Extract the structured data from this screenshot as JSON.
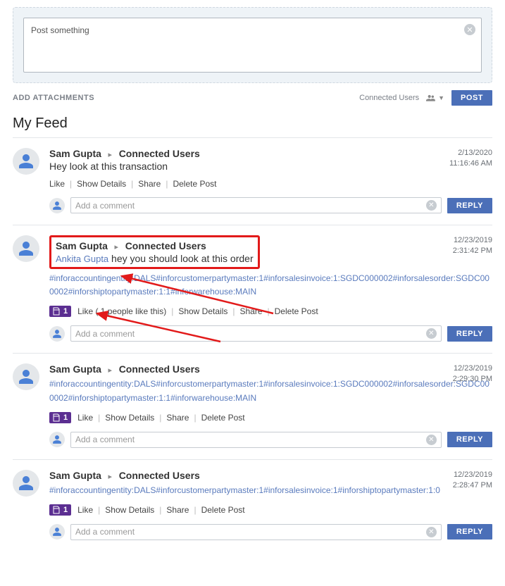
{
  "composer": {
    "placeholder": "Post something"
  },
  "toolbar": {
    "add_attachments": "ADD ATTACHMENTS",
    "connected_users": "Connected Users",
    "post_btn": "POST"
  },
  "feed_title": "My Feed",
  "common": {
    "comment_placeholder": "Add a comment",
    "reply_btn": "REPLY",
    "like": "Like",
    "show_details": "Show Details",
    "share": "Share",
    "delete": "Delete Post"
  },
  "posts": [
    {
      "author": "Sam Gupta",
      "target": "Connected Users",
      "text": "Hey look at this transaction",
      "date": "2/13/2020",
      "time": "11:16:46 AM"
    },
    {
      "author": "Sam Gupta",
      "target": "Connected Users",
      "mention": "Ankita Gupta",
      "text": "hey you should look at this order",
      "tags": "#inforaccountingentity:DALS#inforcustomerpartymaster:1#inforsalesinvoice:1:SGDC000002#inforsalesorder:SGDC000002#inforshiptopartymaster:1:1#inforwarehouse:MAIN",
      "like_label": "Like ( 1 people like this)",
      "badge_count": "1",
      "date": "12/23/2019",
      "time": "2:31:42 PM"
    },
    {
      "author": "Sam Gupta",
      "target": "Connected Users",
      "tags": "#inforaccountingentity:DALS#inforcustomerpartymaster:1#inforsalesinvoice:1:SGDC000002#inforsalesorder:SGDC000002#inforshiptopartymaster:1:1#inforwarehouse:MAIN",
      "badge_count": "1",
      "date": "12/23/2019",
      "time": "2:29:30 PM"
    },
    {
      "author": "Sam Gupta",
      "target": "Connected Users",
      "tags": "#inforaccountingentity:DALS#inforcustomerpartymaster:1#inforsalesinvoice:1#inforshiptopartymaster:1:0",
      "badge_count": "1",
      "date": "12/23/2019",
      "time": "2:28:47 PM"
    }
  ]
}
